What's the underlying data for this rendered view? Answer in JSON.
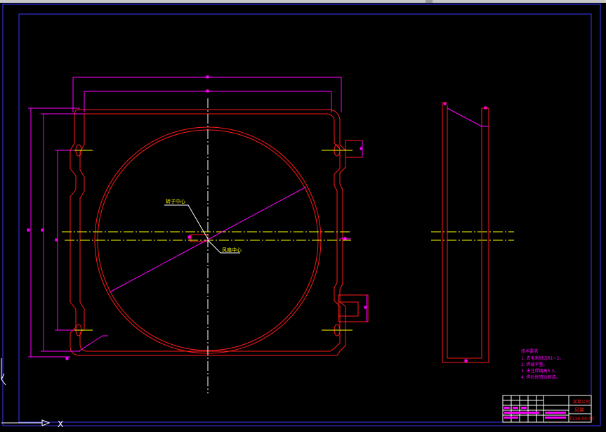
{
  "app": {
    "type": "CAD drawing viewer",
    "background_color": "#000000"
  },
  "colors": {
    "frame": "#3a3aff",
    "outline": "#ff1a1a",
    "dimension": "#ff00ff",
    "centerline": "#ffff00",
    "annotation": "#ffffff",
    "ucs": "#ffffff"
  },
  "callouts": {
    "rotor_center": "转子中心",
    "fan_center": "风扇中心"
  },
  "notes": {
    "heading": "技术要求",
    "lines": [
      "1. 去毛刺锐边R1~2。",
      "2. 焊缝平整。",
      "3. 未注焊缝高5.3。",
      "4. 焊后除锈后刷漆。"
    ]
  },
  "title_block": {
    "company": "某某公司",
    "part_name": "风罩",
    "drawing_no": "T316-00-00"
  },
  "ucs": {
    "x_label": "X"
  }
}
